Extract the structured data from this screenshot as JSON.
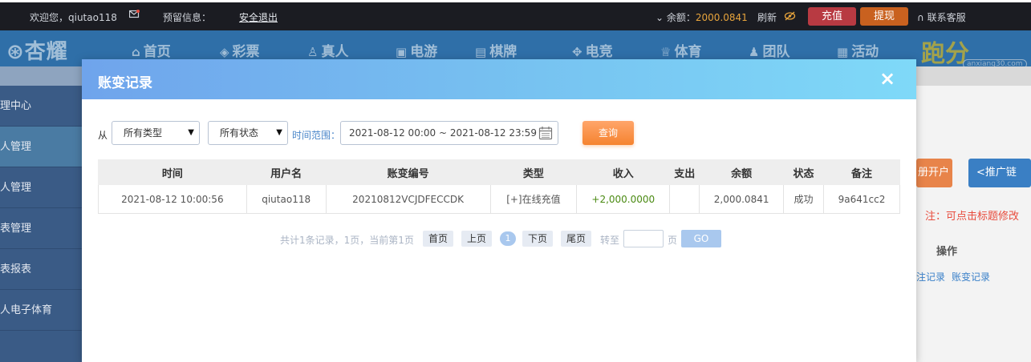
{
  "topbar": {
    "welcome": "欢迎您，qiutao118",
    "reserved_info_label": "预留信息：",
    "logout": "安全退出",
    "balance_label": "余额：",
    "balance_value": "2000.0841",
    "refresh": "刷新",
    "recharge": "充值",
    "withdraw": "提现",
    "support": "联系客服"
  },
  "nav": {
    "logo": "杏耀",
    "items": [
      {
        "label": "首页",
        "icon": "home-icon"
      },
      {
        "label": "彩票",
        "icon": "ticket-icon"
      },
      {
        "label": "真人",
        "icon": "person-icon"
      },
      {
        "label": "电游",
        "icon": "game-icon"
      },
      {
        "label": "棋牌",
        "icon": "cards-icon"
      },
      {
        "label": "电竞",
        "icon": "gamepad-icon"
      },
      {
        "label": "体育",
        "icon": "trophy-icon"
      },
      {
        "label": "团队",
        "icon": "team-icon"
      },
      {
        "label": "活动",
        "icon": "gift-icon"
      }
    ],
    "brand_text": "跑分",
    "watermark": "anxiang30.com"
  },
  "sidebar": {
    "items": [
      {
        "label": "理中心"
      },
      {
        "label": "人管理"
      },
      {
        "label": "人管理"
      },
      {
        "label": "表管理"
      },
      {
        "label": "表报表"
      },
      {
        "label": "人电子体育"
      }
    ]
  },
  "background": {
    "open_account_btn": "册开户",
    "promo_link_btn": "推广链",
    "note": "注：可点击标题修改",
    "ops_header": "操作",
    "link1": "注记录",
    "link2": "账变记录"
  },
  "modal": {
    "title": "账变记录",
    "close": "×",
    "filter": {
      "from_label": "从",
      "type_select": "所有类型",
      "status_select": "所有状态",
      "range_label": "时间范围：",
      "range_value": "2021-08-12 00:00 ~ 2021-08-12 23:59",
      "query_button": "查询"
    },
    "table": {
      "headers": [
        "时间",
        "用户名",
        "账变编号",
        "类型",
        "收入",
        "支出",
        "余额",
        "状态",
        "备注"
      ],
      "rows": [
        [
          "2021-08-12 10:00:56",
          "qiutao118",
          "20210812VCJDFECCDK",
          "[+]在线充值",
          "+2,000.0000",
          "",
          "2,000.0841",
          "成功",
          "9a641cc2"
        ]
      ]
    },
    "pager": {
      "summary": "共计1条记录，1页，当前第1页",
      "first": "首页",
      "prev": "上页",
      "current": "1",
      "next": "下页",
      "last": "尾页",
      "goto_label": "转至",
      "page_unit": "页",
      "go": "GO"
    }
  },
  "colors": {
    "topbar_bg": "#1b1c22",
    "nav_bg": "#2f6fa8",
    "modal_header_start": "#6fa4ec",
    "modal_header_end": "#7fd9f8",
    "query_button": "#f5832f",
    "income_text": "#4a8a12",
    "balance_text": "#e7a43c"
  }
}
